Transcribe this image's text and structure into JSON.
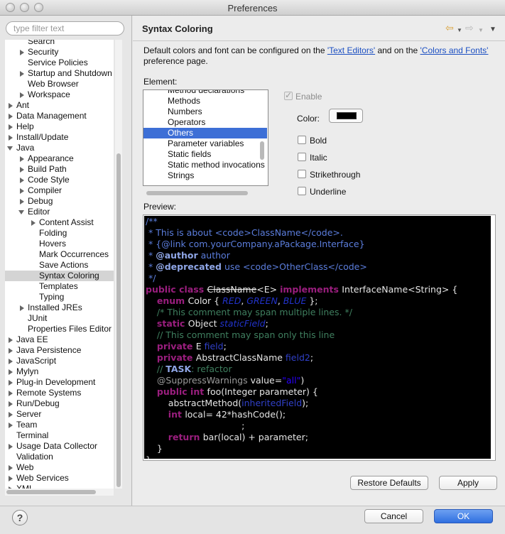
{
  "window": {
    "title": "Preferences"
  },
  "filter": {
    "placeholder": "type filter text"
  },
  "tree": [
    {
      "label": "Search",
      "indent": 2,
      "arrow": "none"
    },
    {
      "label": "Security",
      "indent": 2,
      "arrow": "right"
    },
    {
      "label": "Service Policies",
      "indent": 2,
      "arrow": "none"
    },
    {
      "label": "Startup and Shutdown",
      "indent": 2,
      "arrow": "right"
    },
    {
      "label": "Web Browser",
      "indent": 2,
      "arrow": "none"
    },
    {
      "label": "Workspace",
      "indent": 2,
      "arrow": "right"
    },
    {
      "label": "Ant",
      "indent": 1,
      "arrow": "right"
    },
    {
      "label": "Data Management",
      "indent": 1,
      "arrow": "right"
    },
    {
      "label": "Help",
      "indent": 1,
      "arrow": "right"
    },
    {
      "label": "Install/Update",
      "indent": 1,
      "arrow": "right"
    },
    {
      "label": "Java",
      "indent": 1,
      "arrow": "down"
    },
    {
      "label": "Appearance",
      "indent": 2,
      "arrow": "right"
    },
    {
      "label": "Build Path",
      "indent": 2,
      "arrow": "right"
    },
    {
      "label": "Code Style",
      "indent": 2,
      "arrow": "right"
    },
    {
      "label": "Compiler",
      "indent": 2,
      "arrow": "right"
    },
    {
      "label": "Debug",
      "indent": 2,
      "arrow": "right"
    },
    {
      "label": "Editor",
      "indent": 2,
      "arrow": "down"
    },
    {
      "label": "Content Assist",
      "indent": 3,
      "arrow": "right"
    },
    {
      "label": "Folding",
      "indent": 3,
      "arrow": "none"
    },
    {
      "label": "Hovers",
      "indent": 3,
      "arrow": "none"
    },
    {
      "label": "Mark Occurrences",
      "indent": 3,
      "arrow": "none"
    },
    {
      "label": "Save Actions",
      "indent": 3,
      "arrow": "none"
    },
    {
      "label": "Syntax Coloring",
      "indent": 3,
      "arrow": "none",
      "selected": true
    },
    {
      "label": "Templates",
      "indent": 3,
      "arrow": "none"
    },
    {
      "label": "Typing",
      "indent": 3,
      "arrow": "none"
    },
    {
      "label": "Installed JREs",
      "indent": 2,
      "arrow": "right"
    },
    {
      "label": "JUnit",
      "indent": 2,
      "arrow": "none"
    },
    {
      "label": "Properties Files Editor",
      "indent": 2,
      "arrow": "none"
    },
    {
      "label": "Java EE",
      "indent": 1,
      "arrow": "right"
    },
    {
      "label": "Java Persistence",
      "indent": 1,
      "arrow": "right"
    },
    {
      "label": "JavaScript",
      "indent": 1,
      "arrow": "right"
    },
    {
      "label": "Mylyn",
      "indent": 1,
      "arrow": "right"
    },
    {
      "label": "Plug-in Development",
      "indent": 1,
      "arrow": "right"
    },
    {
      "label": "Remote Systems",
      "indent": 1,
      "arrow": "right"
    },
    {
      "label": "Run/Debug",
      "indent": 1,
      "arrow": "right"
    },
    {
      "label": "Server",
      "indent": 1,
      "arrow": "right"
    },
    {
      "label": "Team",
      "indent": 1,
      "arrow": "right"
    },
    {
      "label": "Terminal",
      "indent": 1,
      "arrow": "none"
    },
    {
      "label": "Usage Data Collector",
      "indent": 1,
      "arrow": "right"
    },
    {
      "label": "Validation",
      "indent": 1,
      "arrow": "none"
    },
    {
      "label": "Web",
      "indent": 1,
      "arrow": "right"
    },
    {
      "label": "Web Services",
      "indent": 1,
      "arrow": "right"
    },
    {
      "label": "XML",
      "indent": 1,
      "arrow": "right"
    }
  ],
  "page": {
    "title": "Syntax Coloring",
    "nav_back_icon": "back-arrow-icon",
    "nav_forward_icon": "forward-arrow-icon",
    "menu_icon": "view-menu-icon",
    "desc_part1": "Default colors and font can be configured on the ",
    "desc_link1": "'Text Editors'",
    "desc_part2": " and on the ",
    "desc_link2": "'Colors and Fonts'",
    "desc_part3": "preference page."
  },
  "element": {
    "label": "Element:",
    "items": [
      "Method declarations",
      "Methods",
      "Numbers",
      "Operators",
      "Others",
      "Parameter variables",
      "Static fields",
      "Static method invocations",
      "Strings"
    ],
    "selected_index": 4
  },
  "options": {
    "enable_label": "Enable",
    "enable_checked": true,
    "color_label": "Color:",
    "color_value": "#000000",
    "bold_label": "Bold",
    "italic_label": "Italic",
    "strikethrough_label": "Strikethrough",
    "underline_label": "Underline"
  },
  "preview": {
    "label": "Preview:",
    "lines": [
      [
        [
          "/**",
          "jdoc"
        ]
      ],
      [
        [
          " * This is about ",
          "jdoc"
        ],
        [
          "<code>",
          "jdoc"
        ],
        [
          "ClassName",
          "jdoc"
        ],
        [
          "</code>",
          "jdoc"
        ],
        [
          ".",
          "jdoc"
        ]
      ],
      [
        [
          " * {@link com.yourCompany.aPackage.Interface}",
          "jdoc"
        ]
      ],
      [
        [
          " * ",
          "jdoc"
        ],
        [
          "@author",
          "tag"
        ],
        [
          " author",
          "jdoc"
        ]
      ],
      [
        [
          " * ",
          "jdoc"
        ],
        [
          "@deprecated",
          "tag"
        ],
        [
          " use ",
          "jdoc"
        ],
        [
          "<code>",
          "jdoc"
        ],
        [
          "OtherClass",
          "jdoc"
        ],
        [
          "</code>",
          "jdoc"
        ]
      ],
      [
        [
          " */",
          "jdoc"
        ]
      ],
      [
        [
          "public class ",
          "kw"
        ],
        [
          "ClassName",
          "strike"
        ],
        [
          "<E> ",
          "plain"
        ],
        [
          "implements ",
          "kw"
        ],
        [
          "InterfaceName<String> {",
          "plain"
        ]
      ],
      [
        [
          "    ",
          "plain"
        ],
        [
          "enum ",
          "kw"
        ],
        [
          "Color { ",
          "plain"
        ],
        [
          "RED",
          "fld"
        ],
        [
          ", ",
          "plain"
        ],
        [
          "GREEN",
          "fld"
        ],
        [
          ", ",
          "plain"
        ],
        [
          "BLUE",
          "fld"
        ],
        [
          " };",
          "plain"
        ]
      ],
      [
        [
          "    /* This comment may span multiple lines. */",
          "com"
        ]
      ],
      [
        [
          "    ",
          "plain"
        ],
        [
          "static ",
          "kw"
        ],
        [
          "Object ",
          "plain"
        ],
        [
          "staticField",
          "fld"
        ],
        [
          ";",
          "plain"
        ]
      ],
      [
        [
          "    // This comment may span only this line",
          "com"
        ]
      ],
      [
        [
          "    ",
          "plain"
        ],
        [
          "private ",
          "kw"
        ],
        [
          "E ",
          "plain"
        ],
        [
          "field",
          "fld2"
        ],
        [
          ";",
          "plain"
        ]
      ],
      [
        [
          "    ",
          "plain"
        ],
        [
          "private ",
          "kw"
        ],
        [
          "AbstractClassName ",
          "plain"
        ],
        [
          "field2",
          "fld2"
        ],
        [
          ";",
          "plain"
        ]
      ],
      [
        [
          "    // ",
          "com"
        ],
        [
          "TASK",
          "tag"
        ],
        [
          ": refactor",
          "com"
        ]
      ],
      [
        [
          "    ",
          "plain"
        ],
        [
          "@SuppressWarnings",
          "ann"
        ],
        [
          " value=",
          "plain"
        ],
        [
          "\"all\"",
          "str"
        ],
        [
          ")",
          "plain"
        ]
      ],
      [
        [
          "    ",
          "plain"
        ],
        [
          "public int ",
          "kw"
        ],
        [
          "foo(Integer parameter) {",
          "plain"
        ]
      ],
      [
        [
          "        abstractMethod(",
          "plain"
        ],
        [
          "inheritedField",
          "fld2"
        ],
        [
          ");",
          "plain"
        ]
      ],
      [
        [
          "        ",
          "plain"
        ],
        [
          "int ",
          "kw"
        ],
        [
          "local= 42*hashCode(",
          "plain"
        ],
        [
          ");",
          "plain"
        ]
      ],
      [
        [
          "                                  ",
          "plain"
        ],
        [
          ";",
          "plain"
        ]
      ],
      [
        [
          "        ",
          "plain"
        ],
        [
          "return ",
          "kw"
        ],
        [
          "bar(local) + parameter;",
          "plain"
        ]
      ],
      [
        [
          "    }",
          "plain"
        ]
      ],
      [
        [
          "}",
          "plain"
        ]
      ]
    ]
  },
  "buttons": {
    "restore_defaults": "Restore Defaults",
    "apply": "Apply",
    "cancel": "Cancel",
    "ok": "OK"
  },
  "help": {
    "icon": "help-icon",
    "glyph": "?"
  }
}
